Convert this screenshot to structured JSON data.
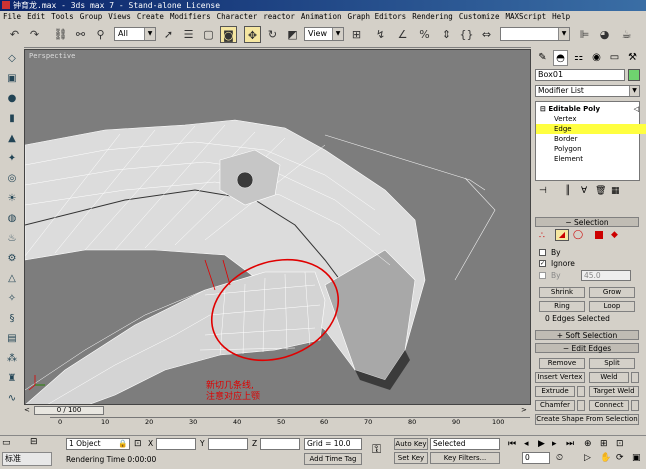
{
  "window": {
    "title": "钟育龙.max - 3ds max 7 - Stand-alone License"
  },
  "menu": [
    "File",
    "Edit",
    "Tools",
    "Group",
    "Views",
    "Create",
    "Modifiers",
    "Character",
    "reactor",
    "Animation",
    "Graph Editors",
    "Rendering",
    "Customize",
    "MAXScript",
    "Help"
  ],
  "toolbar": {
    "selection_filter": "All",
    "ref_coord": "View",
    "icons": [
      "undo-icon",
      "redo-icon",
      "link-icon",
      "unlink-icon",
      "bind-space-warp-icon",
      "select-icon",
      "select-by-name-icon",
      "rect-region-icon",
      "window-crossing-icon",
      "move-icon",
      "rotate-icon",
      "scale-icon",
      "pivot-icon",
      "mirror-icon",
      "align-icon",
      "snap-icon",
      "angle-snap-icon",
      "percent-snap-icon",
      "spinner-snap-icon",
      "named-sets-icon",
      "material-editor-icon",
      "render-icon"
    ]
  },
  "viewport": {
    "label": "Perspective"
  },
  "annotation": {
    "line1": "新切几条线,",
    "line2": "注意对应上颚",
    "color": "#e00000"
  },
  "command_panel": {
    "object_name": "Box01",
    "object_color": "#6fd36f",
    "modifier_list": "Modifier List",
    "stack": {
      "title": "Editable Poly",
      "items": [
        "Vertex",
        "Edge",
        "Border",
        "Polygon",
        "Element"
      ],
      "selected": "Edge"
    },
    "selection": {
      "title": "Selection",
      "by_label": "By",
      "ignore_label": "Ignore",
      "by2_label": "By",
      "angle_value": "45.0",
      "shrink": "Shrink",
      "grow": "Grow",
      "ring": "Ring",
      "loop": "Loop",
      "status": "0 Edges Selected"
    },
    "soft_selection": {
      "title": "Soft Selection"
    },
    "edit_edges": {
      "title": "Edit Edges",
      "remove": "Remove",
      "split": "Split",
      "insert_vertex": "Insert Vertex",
      "weld": "Weld",
      "extrude": "Extrude",
      "target_weld": "Target Weld",
      "chamfer": "Chamfer",
      "connect": "Connect",
      "create_shape": "Create Shape From Selection"
    }
  },
  "timeline": {
    "slider": "0 / 100",
    "ticks": [
      "0",
      "10",
      "20",
      "30",
      "40",
      "50",
      "60",
      "70",
      "80",
      "90",
      "100"
    ]
  },
  "status": {
    "objects": "1 Object",
    "x_label": "X",
    "y_label": "Y",
    "z_label": "Z",
    "grid": "Grid = 10.0",
    "auto_key": "Auto Key",
    "set_key": "Set Key",
    "selected": "Selected",
    "key_filters": "Key Filters...",
    "prompt": "Rendering Time  0:00:00",
    "add_time_tag": "Add Time Tag",
    "frame": "0",
    "ime": "标准"
  }
}
